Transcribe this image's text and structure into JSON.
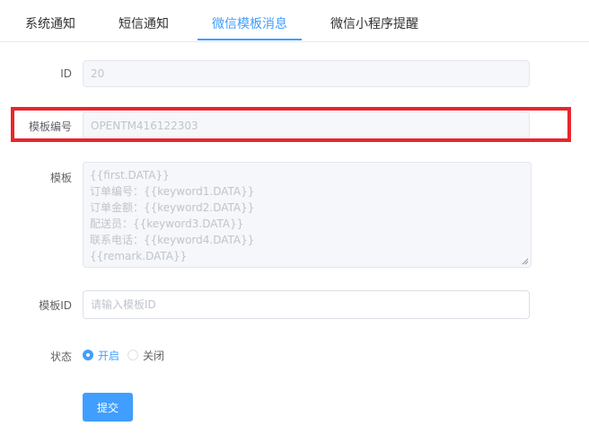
{
  "tabs": [
    {
      "label": "系统通知"
    },
    {
      "label": "短信通知"
    },
    {
      "label": "微信模板消息"
    },
    {
      "label": "微信小程序提醒"
    }
  ],
  "active_tab_index": 2,
  "accent_color": "#409eff",
  "highlight_color": "#e8262b",
  "form": {
    "id": {
      "label": "ID",
      "value": "20"
    },
    "template_code": {
      "label": "模板编号",
      "value": "OPENTM416122303"
    },
    "template": {
      "label": "模板",
      "lines": [
        "{{first.DATA}}",
        "订单编号：{{keyword1.DATA}}",
        "订单金额：{{keyword2.DATA}}",
        "配送员：{{keyword3.DATA}}",
        "联系电话：{{keyword4.DATA}}",
        "{{remark.DATA}}"
      ]
    },
    "template_id": {
      "label": "模板ID",
      "value": "",
      "placeholder": "请输入模板ID"
    },
    "status": {
      "label": "状态",
      "options": [
        "开启",
        "关闭"
      ],
      "selected": "开启"
    },
    "submit_label": "提交"
  }
}
